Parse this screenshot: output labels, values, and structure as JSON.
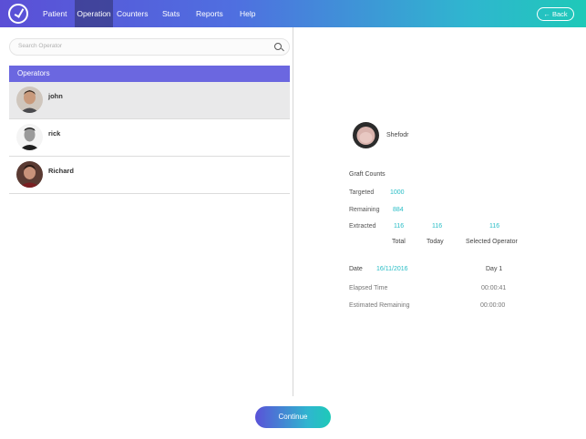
{
  "nav": {
    "items": [
      "Patient",
      "Operation",
      "Counters",
      "Stats",
      "Reports",
      "Help"
    ],
    "active": "Operation",
    "back_label": "Back"
  },
  "search": {
    "placeholder": "Search Operator"
  },
  "operators": {
    "header": "Operators",
    "items": [
      {
        "name": "john",
        "selected": true
      },
      {
        "name": "rick",
        "selected": false
      },
      {
        "name": "Richard",
        "selected": false
      }
    ]
  },
  "patient": {
    "name": "Shefodr"
  },
  "graft": {
    "title": "Graft Counts",
    "targeted_label": "Targeted",
    "targeted_value": "1000",
    "remaining_label": "Remaining",
    "remaining_value": "884",
    "extracted_label": "Extracted",
    "extracted_total": "116",
    "extracted_today": "116",
    "extracted_selected": "116",
    "col_total": "Total",
    "col_today": "Today",
    "col_selected": "Selected Operator"
  },
  "session": {
    "date_label": "Date",
    "date_value": "16/11/2016",
    "day_label": "Day 1",
    "elapsed_label": "Elapsed Time",
    "elapsed_value": "00:00:41",
    "estimated_label": "Estimated Remaining",
    "estimated_value": "00:00:00"
  },
  "continue_label": "Continue",
  "colors": {
    "accent": "#6b67e0",
    "teal": "#28bdc6",
    "selected_row": "#e9e9ea"
  }
}
